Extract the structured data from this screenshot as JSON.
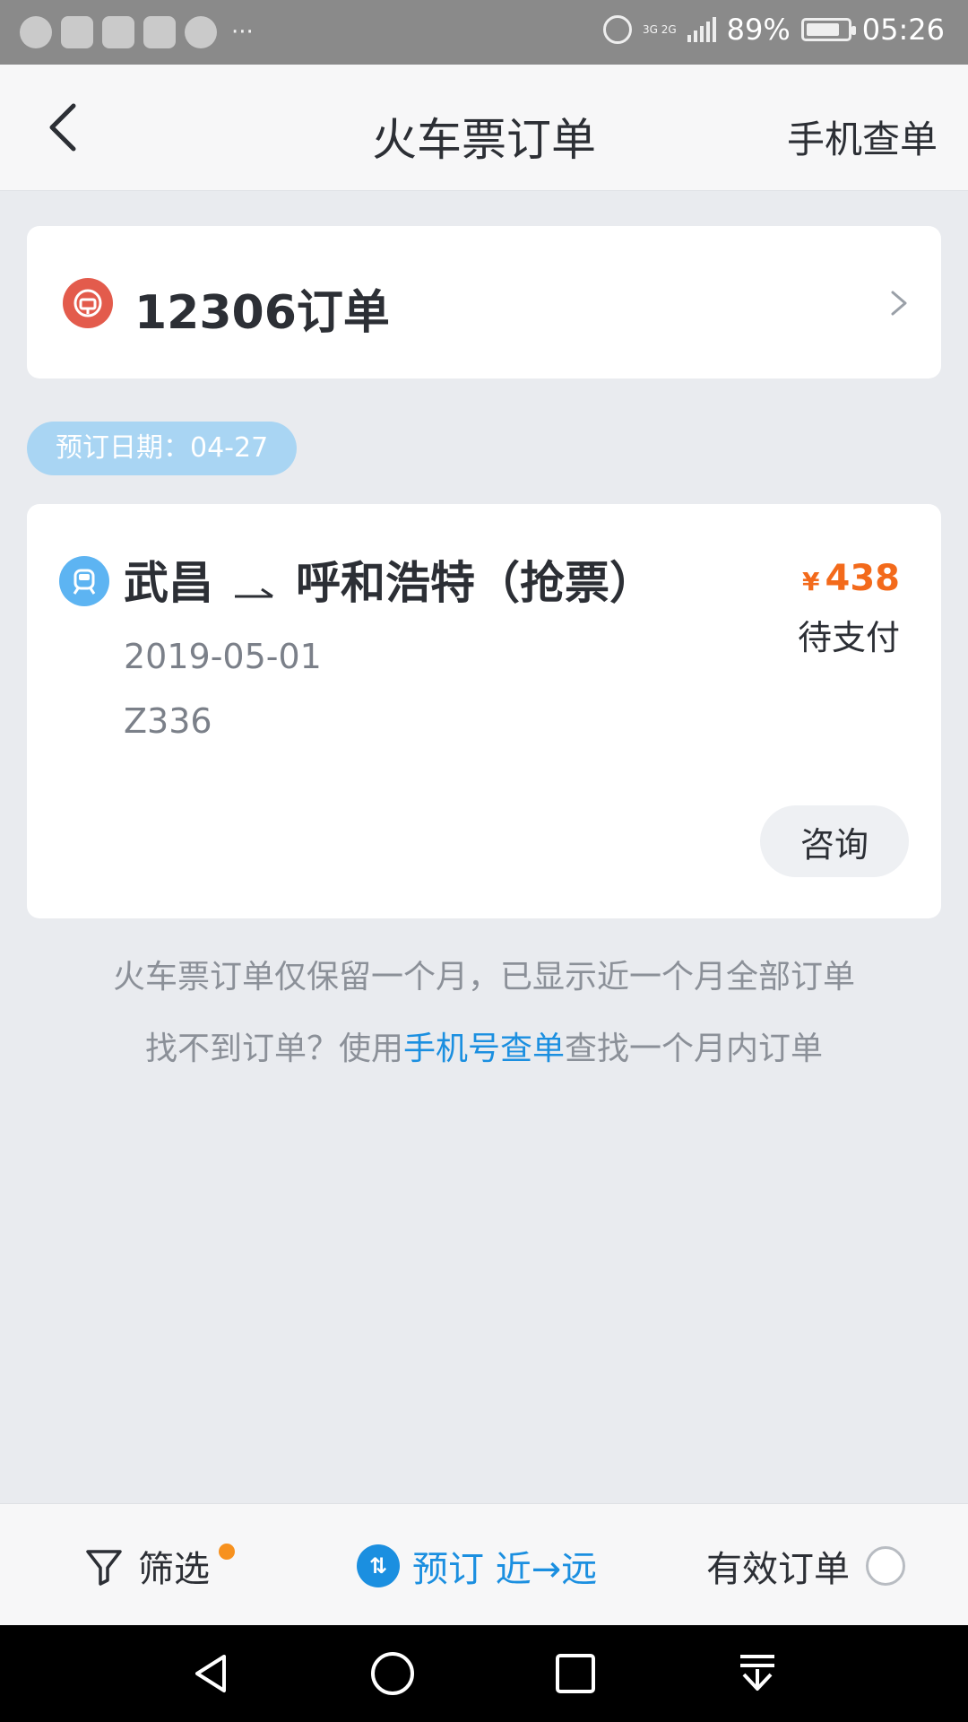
{
  "status_bar": {
    "battery": "89%",
    "time": "05:26",
    "network": "3G 2G"
  },
  "header": {
    "title": "火车票订单",
    "right_action": "手机查单"
  },
  "order_source": {
    "label": "12306订单"
  },
  "booking_date": "预订日期：04-27",
  "order": {
    "from": "武昌",
    "to": "呼和浩特（抢票）",
    "currency": "¥",
    "price": "438",
    "status": "待支付",
    "date": "2019-05-01",
    "train_no": "Z336",
    "consult_label": "咨询"
  },
  "notes": {
    "line1": "火车票订单仅保留一个月，已显示近一个月全部订单",
    "line2_pre": "找不到订单？使用",
    "line2_link": "手机号查单",
    "line2_post": "查找一个月内订单"
  },
  "bottom_bar": {
    "filter_label": "筛选",
    "sort_label": "预订 近→远",
    "valid_label": "有效订单"
  },
  "colors": {
    "accent": "#1b8fe0",
    "price": "#f36a1b",
    "pill": "#a9d5f3"
  }
}
